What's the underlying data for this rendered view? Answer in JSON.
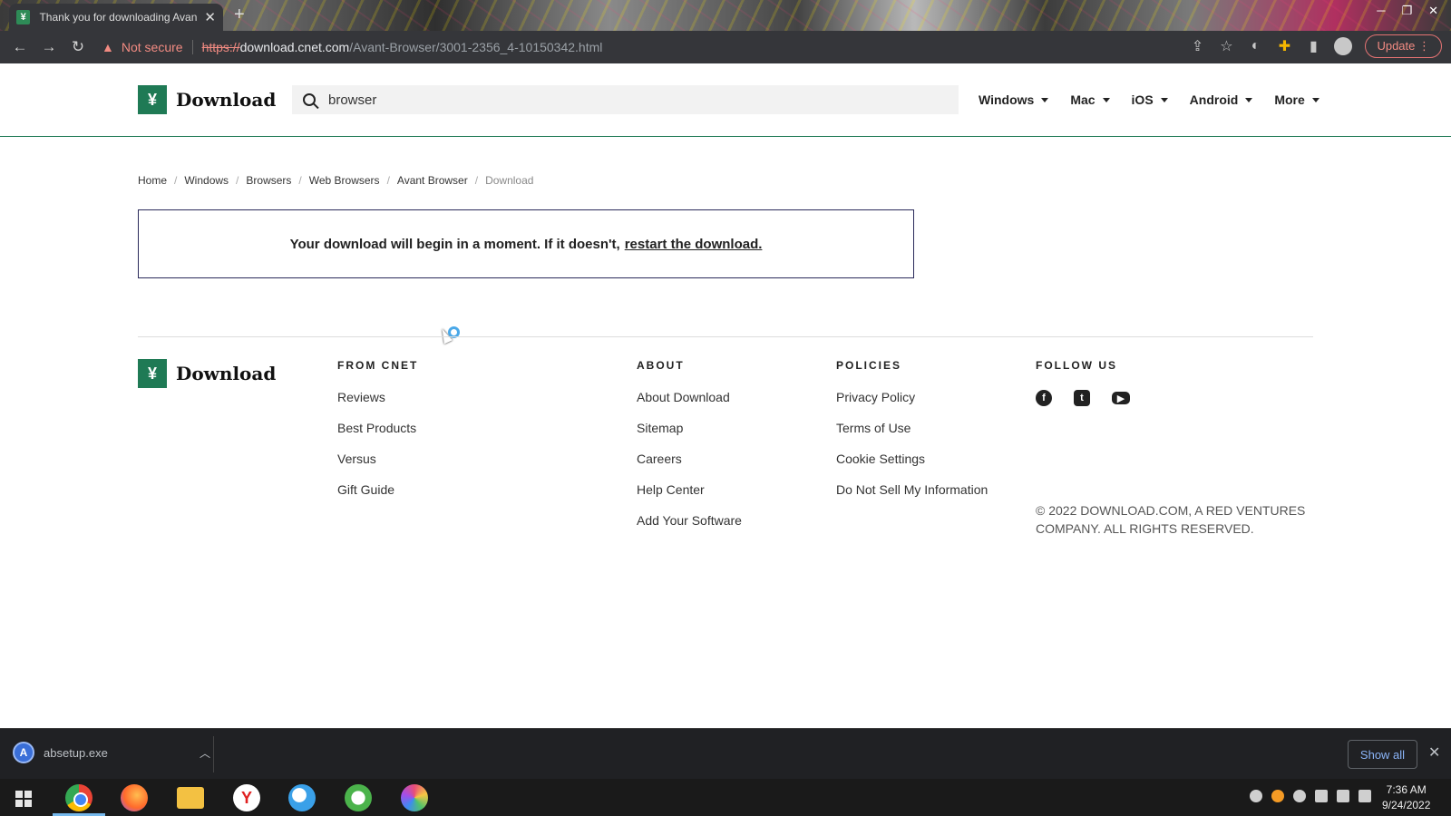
{
  "browser": {
    "tab_title": "Thank you for downloading Avant",
    "tab_favicon": "¥",
    "tab_close": "✕",
    "new_tab": "+",
    "security_warning": "Not secure",
    "url_scheme": "https://",
    "url_host": "download.cnet.com",
    "url_path": "/Avant-Browser/3001-2356_4-10150342.html",
    "update_label": "Update"
  },
  "header": {
    "logo_text": "Download",
    "logo_mark": "¥",
    "search_value": "browser",
    "nav": [
      "Windows",
      "Mac",
      "iOS",
      "Android",
      "More"
    ]
  },
  "breadcrumb": [
    "Home",
    "Windows",
    "Browsers",
    "Web Browsers",
    "Avant Browser",
    "Download"
  ],
  "message": {
    "text": "Your download will begin in a moment. If it doesn't,",
    "link": "restart the download."
  },
  "footer": {
    "logo_text": "Download",
    "from_cnet": {
      "heading": "FROM CNET",
      "links": [
        "Reviews",
        "Best Products",
        "Versus",
        "Gift Guide"
      ]
    },
    "about": {
      "heading": "ABOUT",
      "links": [
        "About Download",
        "Sitemap",
        "Careers",
        "Help Center",
        "Add Your Software"
      ]
    },
    "policies": {
      "heading": "POLICIES",
      "links": [
        "Privacy Policy",
        "Terms of Use",
        "Cookie Settings",
        "Do Not Sell My Information"
      ]
    },
    "follow": {
      "heading": "FOLLOW US",
      "icons": [
        "facebook-icon",
        "twitter-icon",
        "youtube-icon"
      ]
    },
    "copyright": "© 2022 DOWNLOAD.COM, A RED VENTURES COMPANY. ALL RIGHTS RESERVED."
  },
  "download_bar": {
    "file_name": "absetup.exe",
    "show_all": "Show all"
  },
  "taskbar": {
    "time": "7:36 AM",
    "date": "9/24/2022"
  },
  "colors": {
    "brand_green": "#1f7a55",
    "link_blue": "#8ab4f8",
    "warning_red": "#f28b82"
  }
}
